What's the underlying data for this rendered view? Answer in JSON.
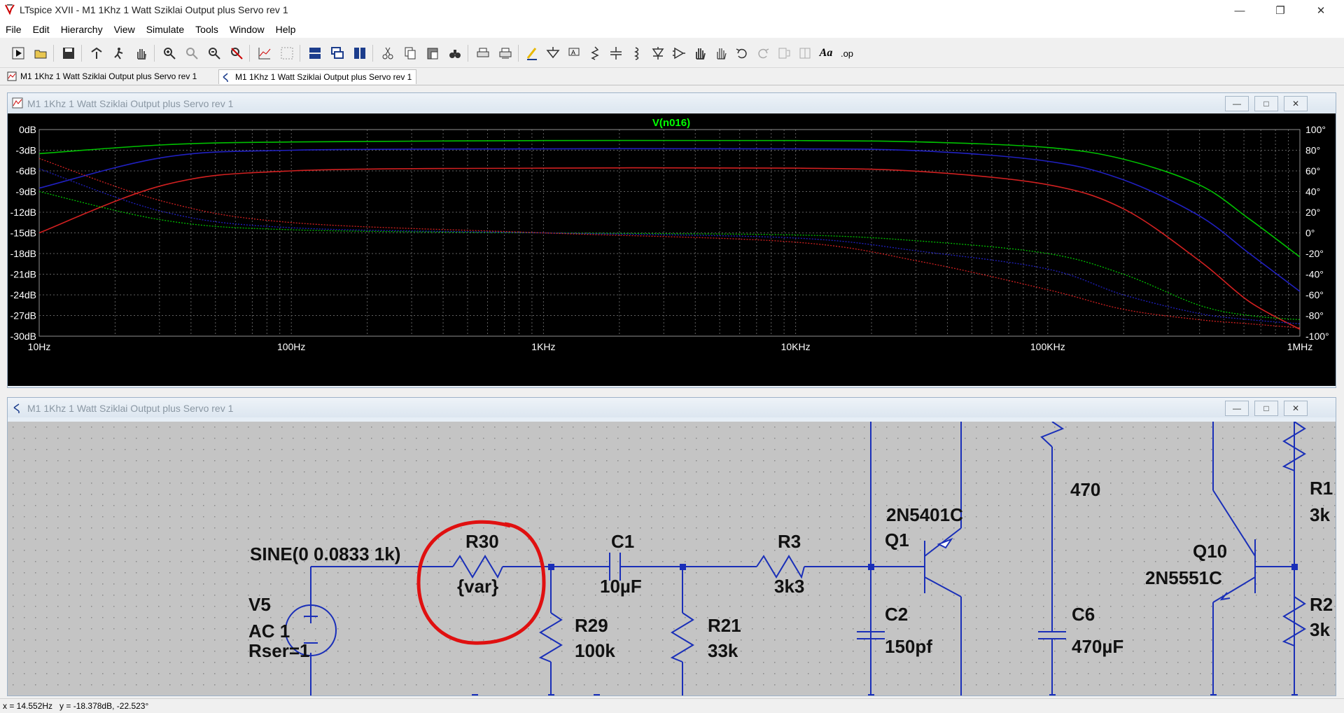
{
  "app": {
    "window_title": "LTspice XVII - M1 1Khz 1 Watt Sziklai Output plus Servo rev 1"
  },
  "menu": {
    "items": [
      "File",
      "Edit",
      "Hierarchy",
      "View",
      "Simulate",
      "Tools",
      "Window",
      "Help"
    ]
  },
  "toolbar": {
    "icons": [
      "run-icon",
      "open-icon",
      "save-icon",
      "control-panel-icon",
      "halt-icon",
      "pan-icon",
      "zoom-in-icon",
      "zoom-area-icon",
      "zoom-out-icon",
      "zoom-cancel-icon",
      "plot-settings-icon",
      "autorange-icon",
      "tile-horizontal-icon",
      "cascade-icon",
      "tile-vertical-icon",
      "cut-icon",
      "copy-icon",
      "paste-icon",
      "find-icon",
      "print-icon",
      "print-setup-icon",
      "wire-icon",
      "ground-icon",
      "label-net-icon",
      "resistor-icon",
      "capacitor-icon",
      "inductor-icon",
      "diode-icon",
      "component-icon",
      "move-icon",
      "drag-icon",
      "undo-icon",
      "redo-icon",
      "rotate-icon",
      "mirror-icon",
      "text-icon",
      "spice-directive-icon"
    ],
    "spice_directive_label": ".op",
    "text_label": "Aa"
  },
  "doc_tabs": [
    {
      "label": "M1 1Khz 1 Watt Sziklai Output plus Servo rev 1",
      "icon": "waveform-icon",
      "active": false
    },
    {
      "label": "M1 1Khz 1 Watt Sziklai Output plus Servo rev 1",
      "icon": "schematic-icon",
      "active": true
    }
  ],
  "waveform_window": {
    "title": "M1 1Khz 1 Watt Sziklai Output plus Servo rev 1",
    "trace_label": "V(n016)",
    "trace_label_color": "#00ff00"
  },
  "schematic_window": {
    "title": "M1 1Khz 1 Watt Sziklai Output plus Servo rev 1",
    "labels": {
      "sine": "SINE(0 0.0833 1k)",
      "v5": "V5",
      "ac": "AC 1",
      "rser": "Rser=1",
      "r30": "R30",
      "r30_val": "{var}",
      "c1": "C1",
      "c1_val": "10µF",
      "r3": "R3",
      "r3_val": "3k3",
      "r29": "R29",
      "r29_val": "100k",
      "r21": "R21",
      "r21_val": "33k",
      "q1_part": "2N5401C",
      "q1": "Q1",
      "c2": "C2",
      "c2_val": "150pf",
      "r470": "470",
      "c6": "C6",
      "c6_val": "470µF",
      "q10": "Q10",
      "q10_part": "2N5551C",
      "r1_cut": "R1",
      "r1_val_cut": "3k",
      "r2_cut": "R2",
      "r2_val_cut": "3k"
    }
  },
  "chart_data": {
    "type": "line",
    "title": "V(n016)",
    "x_scale": "log",
    "xlim": [
      10,
      1000000
    ],
    "x_ticks": [
      "10Hz",
      "100Hz",
      "1KHz",
      "10KHz",
      "100KHz",
      "1MHz"
    ],
    "y_left_ticks": [
      "0dB",
      "-3dB",
      "-6dB",
      "-9dB",
      "-12dB",
      "-15dB",
      "-18dB",
      "-21dB",
      "-24dB",
      "-27dB",
      "-30dB"
    ],
    "ylim_left": [
      -30,
      0
    ],
    "y_right_ticks": [
      "100°",
      "80°",
      "60°",
      "40°",
      "20°",
      "0°",
      "-20°",
      "-40°",
      "-60°",
      "-80°",
      "-100°"
    ],
    "ylim_right": [
      -100,
      100
    ],
    "grid": true,
    "x_log_values": [
      1,
      1.5,
      2,
      3,
      4,
      4.5,
      5,
      5.3,
      5.6,
      5.8,
      6
    ],
    "series": [
      {
        "color": "#00c000",
        "style": "solid",
        "axis": "left",
        "values": [
          -3.5,
          -2.2,
          -1.8,
          -1.6,
          -1.6,
          -1.8,
          -2.6,
          -4.3,
          -8,
          -13,
          -18.5
        ]
      },
      {
        "color": "#2020c0",
        "style": "solid",
        "axis": "left",
        "values": [
          -8.5,
          -4,
          -3,
          -2.8,
          -2.8,
          -3.1,
          -4.6,
          -7.3,
          -12.5,
          -18,
          -23.5
        ]
      },
      {
        "color": "#d02020",
        "style": "solid",
        "axis": "left",
        "values": [
          -15,
          -8,
          -6,
          -5.6,
          -5.6,
          -6.1,
          -8,
          -11.5,
          -19,
          -25,
          -29
        ]
      },
      {
        "color": "#00c000",
        "style": "dotted",
        "axis": "right",
        "values": [
          40,
          12,
          3,
          0,
          -2,
          -8,
          -20,
          -40,
          -70,
          -80,
          -84
        ]
      },
      {
        "color": "#2020c0",
        "style": "dotted",
        "axis": "right",
        "values": [
          62,
          20,
          5,
          0,
          -5,
          -18,
          -35,
          -60,
          -78,
          -84,
          -88
        ]
      },
      {
        "color": "#d02020",
        "style": "dotted",
        "axis": "right",
        "values": [
          72,
          30,
          10,
          0,
          -9,
          -28,
          -55,
          -74,
          -84,
          -88,
          -92
        ]
      }
    ]
  },
  "status": {
    "text": "x = 14.552Hz   y = -18.378dB, -22.523°"
  }
}
